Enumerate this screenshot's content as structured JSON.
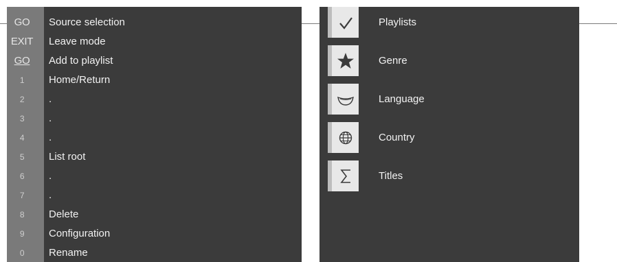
{
  "remote_keys": [
    {
      "key": "GO",
      "label": "Source selection"
    },
    {
      "key": "EXIT",
      "label": "Leave mode"
    },
    {
      "key": "GO",
      "label": "Add to playlist"
    },
    {
      "key": "1",
      "label": "Home/Return"
    },
    {
      "key": "2",
      "label": "."
    },
    {
      "key": "3",
      "label": "."
    },
    {
      "key": "4",
      "label": "."
    },
    {
      "key": "5",
      "label": "List root"
    },
    {
      "key": "6",
      "label": "."
    },
    {
      "key": "7",
      "label": "."
    },
    {
      "key": "8",
      "label": "Delete"
    },
    {
      "key": "9",
      "label": "Configuration"
    },
    {
      "key": "0",
      "label": "Rename"
    }
  ],
  "menu": [
    {
      "icon": "check-icon",
      "label": "Playlists"
    },
    {
      "icon": "star-icon",
      "label": "Genre"
    },
    {
      "icon": "lips-icon",
      "label": "Language"
    },
    {
      "icon": "globe-icon",
      "label": "Country"
    },
    {
      "icon": "sigma-icon",
      "label": "Titles"
    }
  ]
}
